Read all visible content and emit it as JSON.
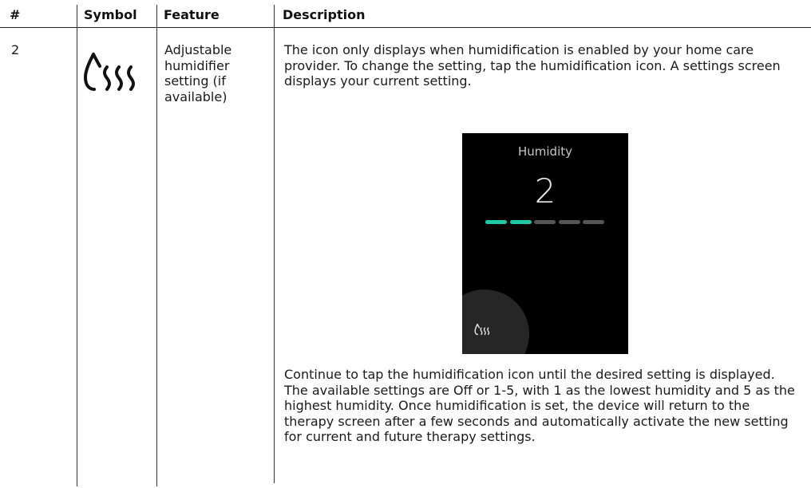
{
  "headers": {
    "num": "#",
    "symbol": "Symbol",
    "feature": "Feature",
    "description": "Description"
  },
  "row": {
    "num": "2",
    "symbol_icon": "humidifier-icon",
    "feature": "Adjustable humidifier setting (if available)",
    "description_1": "The icon only displays when humidification is enabled by your home care provider. To change the setting, tap the humidification icon. A settings screen displays your current setting.",
    "description_2": "Continue to tap the humidification icon until the desired setting is displayed. The available settings are Off or 1-5, with 1 as the lowest humidity and 5 as the highest humidity. Once humidification is set, the device will return to the therapy screen after a few seconds and automatically activate the new setting for current and future therapy settings."
  },
  "device_screen": {
    "title": "Humidity",
    "value": "2",
    "level": 2,
    "max_level": 5,
    "active_color": "#1ec9a8",
    "inactive_color": "#555555",
    "background": "#000000",
    "icon": "humidifier-icon"
  }
}
